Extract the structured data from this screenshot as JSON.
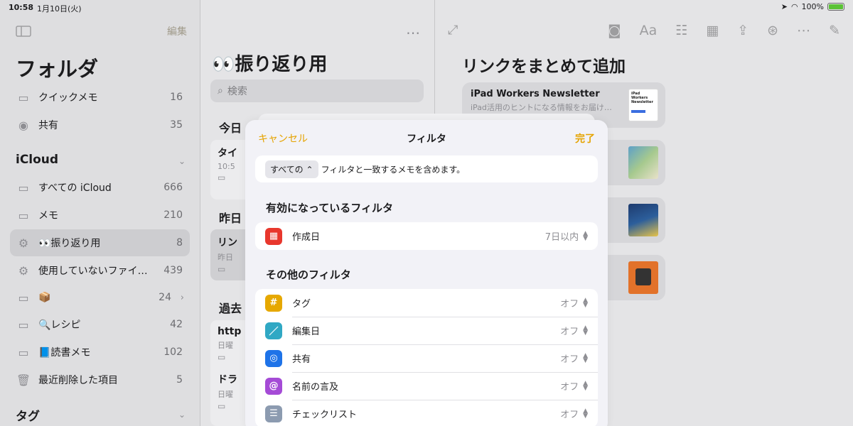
{
  "status": {
    "time": "10:58",
    "date": "1月10日(火)",
    "battery": "100%"
  },
  "sidebar": {
    "edit": "編集",
    "title": "フォルダ",
    "top_items": [
      {
        "icon": "quick-note-icon",
        "label": "クイックメモ",
        "count": "16"
      },
      {
        "icon": "person-icon",
        "label": "共有",
        "count": "35"
      }
    ],
    "section_icloud": "iCloud",
    "icloud_items": [
      {
        "label": "すべての iCloud",
        "count": "666"
      },
      {
        "label": "メモ",
        "count": "210"
      },
      {
        "label": "👀振り返り用",
        "count": "8"
      },
      {
        "label": "使用していないファイル…",
        "count": "439"
      },
      {
        "label": "📦",
        "count": "24"
      },
      {
        "label": "🔍レシピ",
        "count": "42"
      },
      {
        "label": "📘読書メモ",
        "count": "102"
      },
      {
        "label": "最近削除した項目",
        "count": "5"
      }
    ],
    "section_tags": "タグ"
  },
  "list": {
    "title": "👀振り返り用",
    "search_placeholder": "検索",
    "groups": {
      "today": "今日",
      "yesterday": "昨日",
      "past": "過去"
    },
    "notes": [
      {
        "title": "タイ",
        "sub": "10:5"
      },
      {
        "title": "リン",
        "sub": "昨日"
      },
      {
        "title": "http",
        "sub": "日曜"
      },
      {
        "title": "ドラ",
        "sub": "日曜"
      }
    ]
  },
  "editor": {
    "title": "リンクをまとめて追加",
    "card": {
      "title": "iPad Workers Newsletter",
      "desc": "iPad活用のヒントになる情報をお届け…",
      "thumb_text": "iPad Workers Newsletter"
    },
    "toolbar_text_icon": "Aa"
  },
  "modal": {
    "cancel": "キャンセル",
    "title": "フィルタ",
    "done": "完了",
    "match_select": "すべての",
    "match_text": "フィルタと一致するメモを含めます。",
    "active_header": "有効になっているフィルタ",
    "active": [
      {
        "icon": "calendar-icon",
        "color": "#e8372d",
        "label": "作成日",
        "value": "7日以内"
      }
    ],
    "other_header": "その他のフィルタ",
    "others": [
      {
        "icon": "hashtag-icon",
        "glyph": "#",
        "color": "#e6a800",
        "label": "タグ",
        "value": "オフ"
      },
      {
        "icon": "pencil-icon",
        "glyph": "／",
        "color": "#30a8c4",
        "label": "編集日",
        "value": "オフ"
      },
      {
        "icon": "shared-icon",
        "glyph": "◎",
        "color": "#1e73e8",
        "label": "共有",
        "value": "オフ"
      },
      {
        "icon": "at-icon",
        "glyph": "@",
        "color": "#a54bd6",
        "label": "名前の言及",
        "value": "オフ"
      },
      {
        "icon": "checklist-icon",
        "glyph": "☰",
        "color": "#8c9bb0",
        "label": "チェックリスト",
        "value": "オフ"
      }
    ]
  }
}
